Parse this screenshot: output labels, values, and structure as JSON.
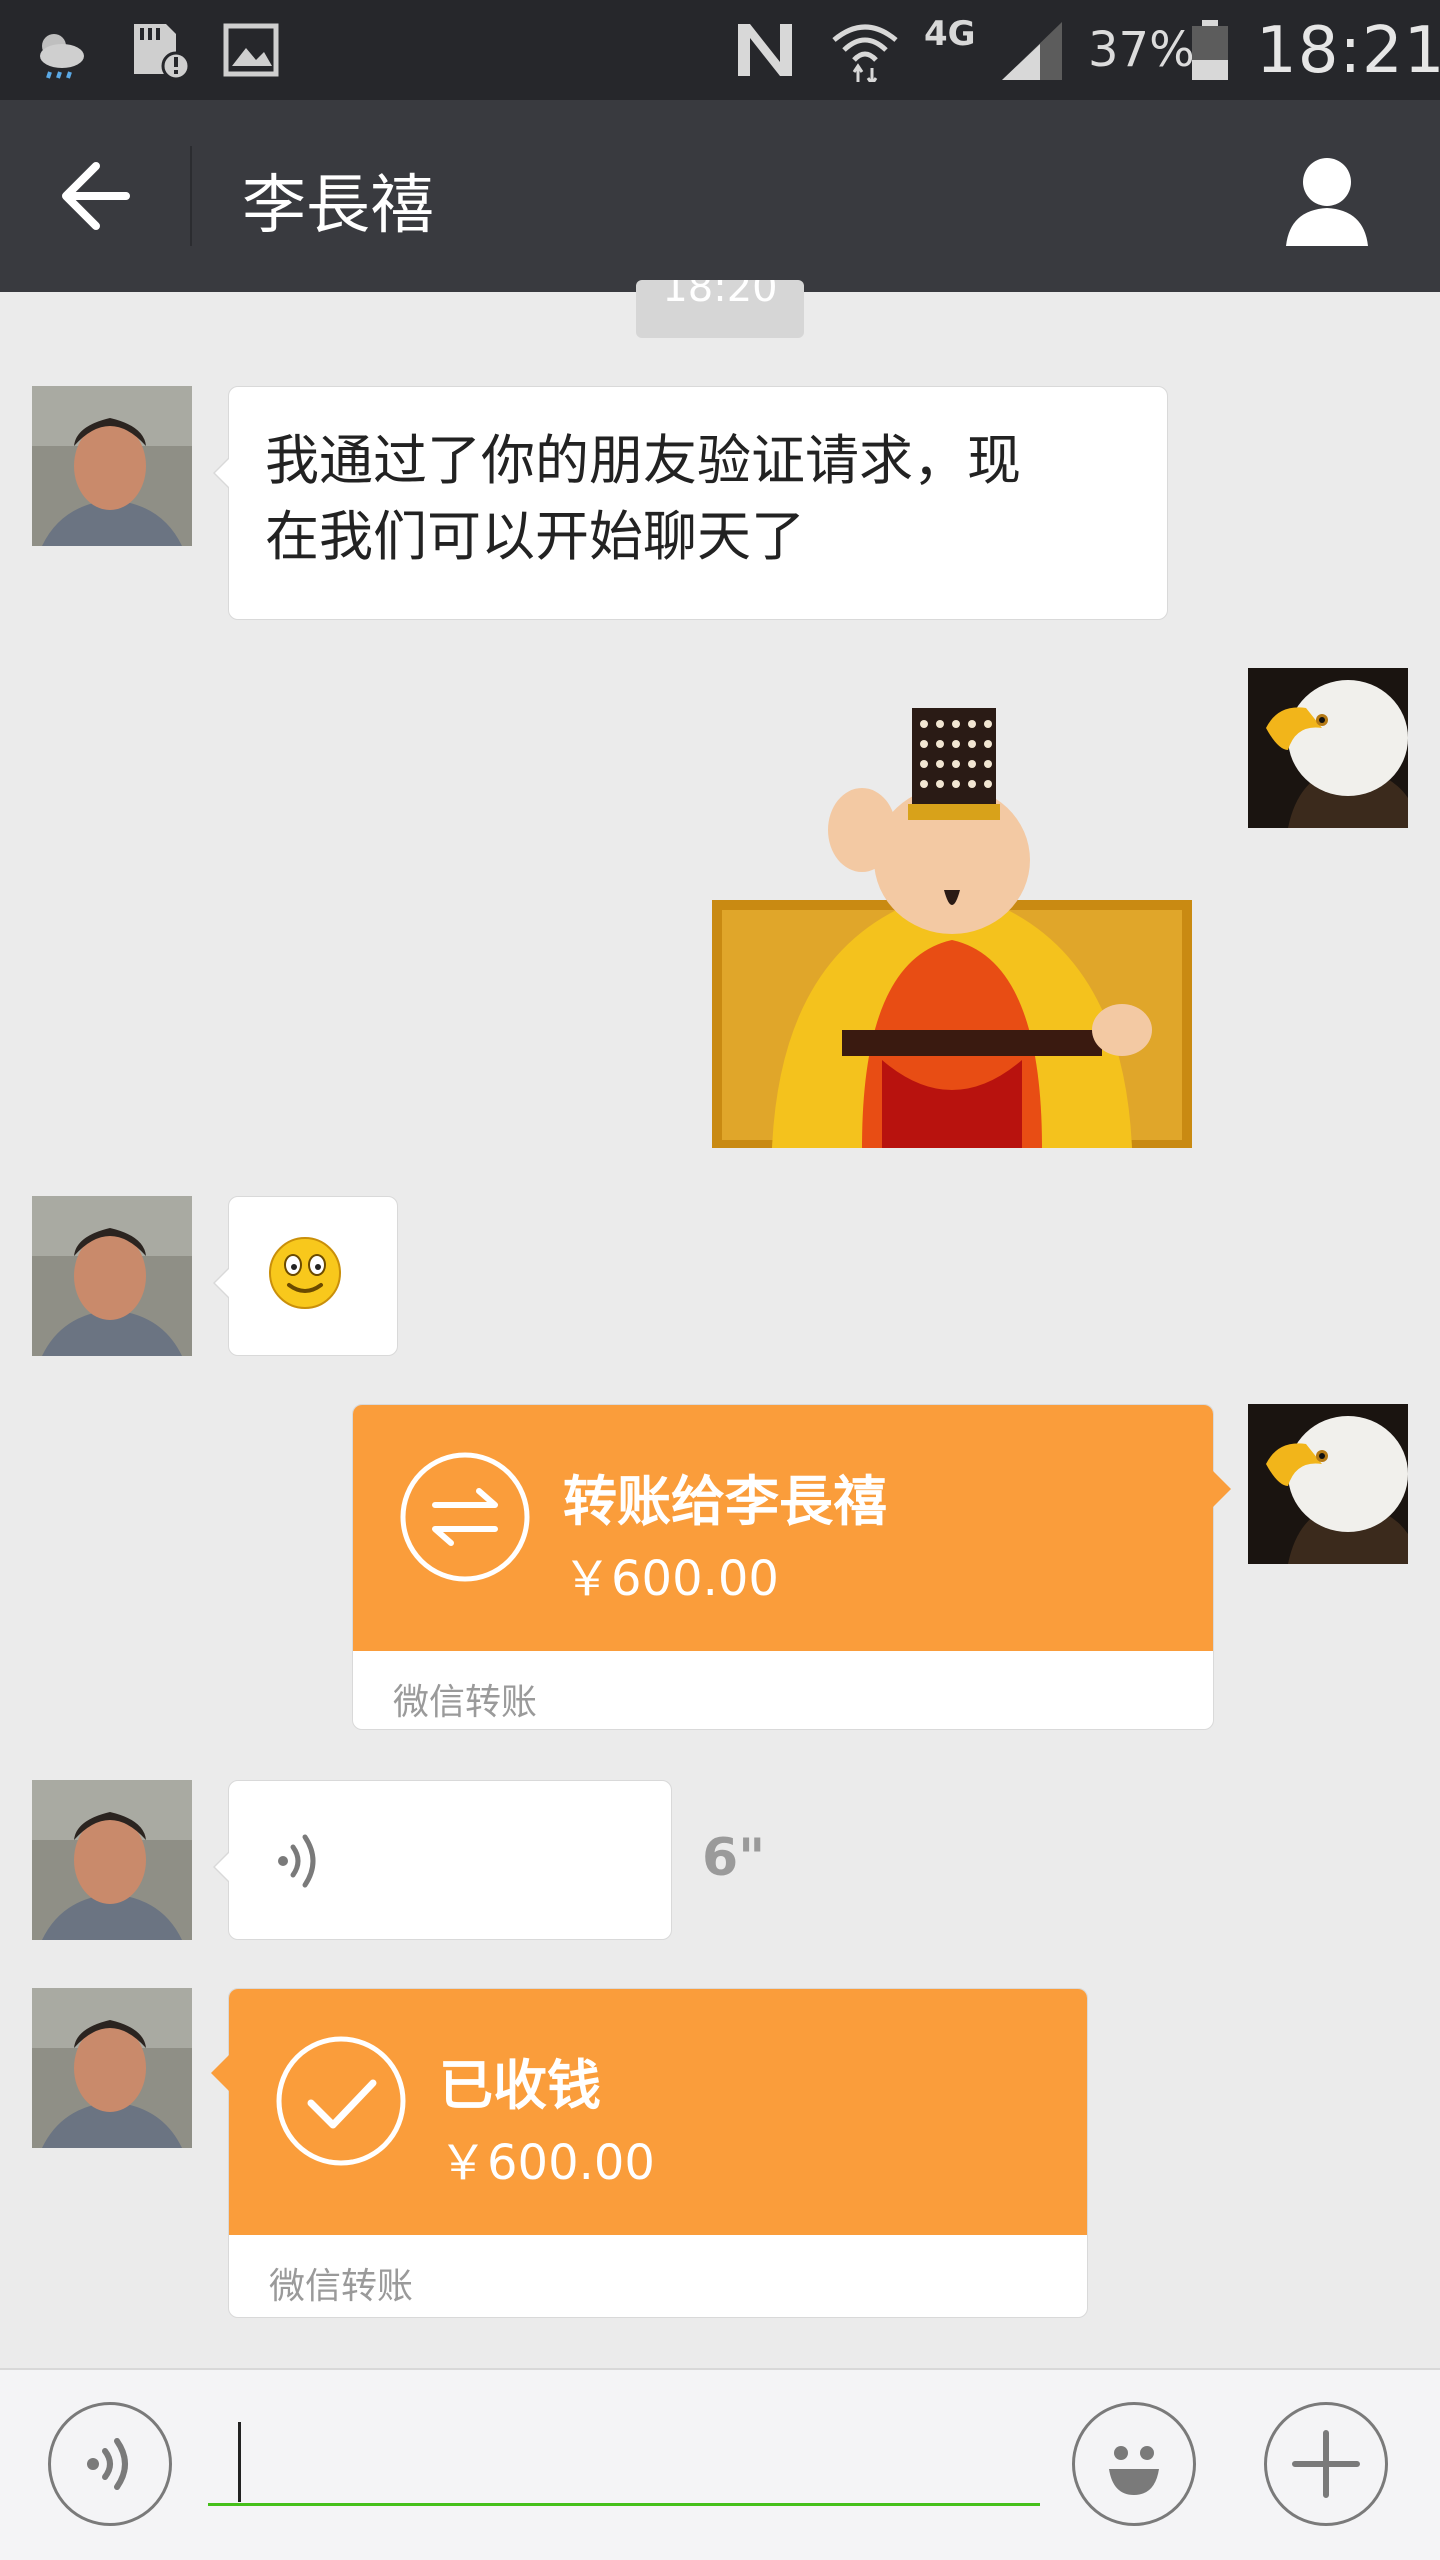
{
  "status_bar": {
    "battery_percent": "37%",
    "time": "18:21",
    "network": "4G"
  },
  "header": {
    "title": "李長禧"
  },
  "chat": {
    "timestamp": "18:20",
    "messages": [
      {
        "type": "text",
        "sender": "contact",
        "text_line1": "我通过了你的朋友验证请求，现",
        "text_line2": "在我们可以开始聊天了"
      },
      {
        "type": "sticker",
        "sender": "me"
      },
      {
        "type": "emoji",
        "sender": "contact"
      },
      {
        "type": "transfer",
        "sender": "me",
        "title": "转账给李長禧",
        "amount": "￥600.00",
        "footer": "微信转账"
      },
      {
        "type": "voice",
        "sender": "contact",
        "duration": "6\""
      },
      {
        "type": "transfer_received",
        "sender": "contact",
        "title": "已收钱",
        "amount": "￥600.00",
        "footer": "微信转账"
      }
    ]
  },
  "colors": {
    "transfer_orange": "#fa9d3b",
    "title_bar": "#393a3f",
    "input_underline": "#45c01a"
  },
  "input": {
    "value": "",
    "placeholder": ""
  }
}
